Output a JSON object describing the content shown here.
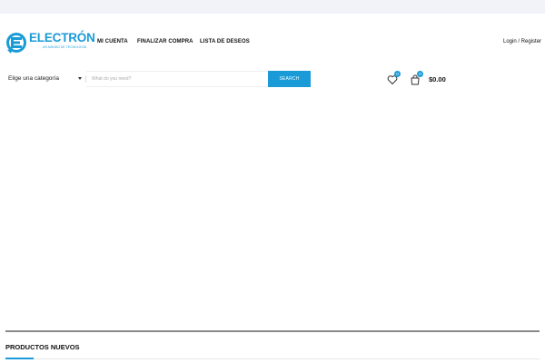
{
  "header": {
    "logo": {
      "name": "ELECTRÓN",
      "tagline": "UN MUNDO DE TECNOLOGIA"
    },
    "nav": [
      {
        "label": "MI CUENTA"
      },
      {
        "label": "FINALIZAR COMPRA"
      },
      {
        "label": "LISTA DE DESEOS"
      }
    ],
    "login": "Login / Register"
  },
  "search": {
    "category_label": "Elige una categoría",
    "placeholder": "What do you need?",
    "button_label": "SEARCH"
  },
  "wishlist": {
    "count": "0",
    "icon": "heart-icon"
  },
  "cart": {
    "count": "0",
    "total": "$0.00",
    "icon": "shopping-bag-icon"
  },
  "section": {
    "title": "PRODUCTOS NUEVOS"
  },
  "colors": {
    "accent": "#1a9bd7",
    "topbar": "#f1f3f9"
  }
}
